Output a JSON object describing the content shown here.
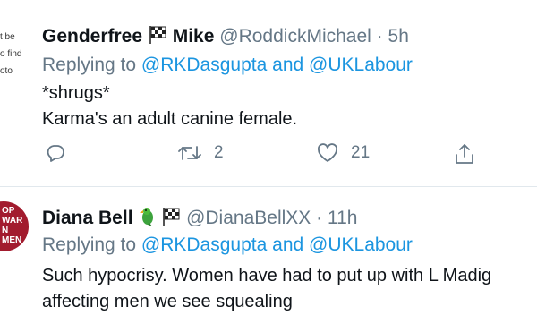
{
  "edge_snippet": [
    "t be",
    "o find",
    "oto"
  ],
  "tweets": [
    {
      "name": "Genderfree",
      "name2": "Mike",
      "handle": "@RoddickMichael",
      "sep": "·",
      "time": "5h",
      "replying_prefix": "Replying to",
      "mention1": "@RKDasgupta",
      "and_word": "and",
      "mention2": "@UKLabour",
      "lines": [
        "*shrugs*",
        "Karma's an adult canine female."
      ],
      "retweets": "2",
      "likes": "21"
    },
    {
      "name": "Diana Bell",
      "handle": "@DianaBellXX",
      "sep": "·",
      "time": "11h",
      "replying_prefix": "Replying to",
      "mention1": "@RKDasgupta",
      "and_word": "and",
      "mention2": "@UKLabour",
      "lines": [
        "Such hypocrisy. Women have had to put up with L Madig",
        "affecting men we see squealing"
      ],
      "avatar_text": [
        "OP",
        "WAR",
        "N",
        "MEN"
      ]
    }
  ],
  "icons": [
    "reply-icon",
    "retweet-icon",
    "like-icon",
    "share-icon",
    "chequered-flag-icon",
    "parrot-icon"
  ],
  "colors": {
    "link": "#1b95e0",
    "muted": "#657786",
    "text": "#0f1419",
    "divider": "#e1e8ed"
  }
}
